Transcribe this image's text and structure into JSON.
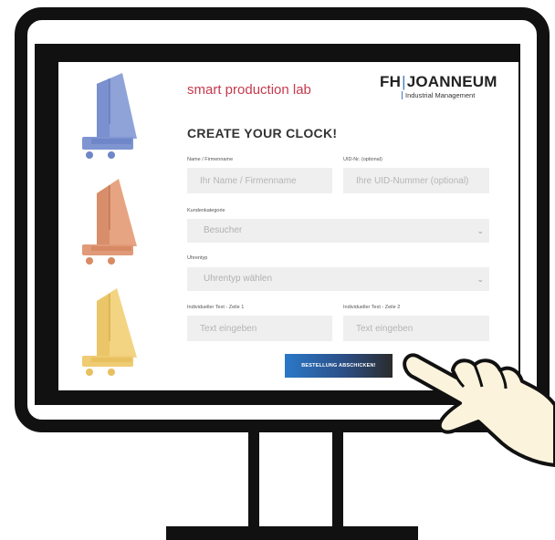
{
  "brand": {
    "lab_name": "smart production lab",
    "university_fh": "FH",
    "university_name": "JOANNEUM",
    "university_sub": "Industrial Management"
  },
  "form": {
    "title": "CREATE YOUR CLOCK!",
    "name_label": "Name / Firmenname",
    "name_placeholder": "Ihr Name / Firmenname",
    "uid_label": "UID-Nr. (optional)",
    "uid_placeholder": "Ihre UID-Nummer (optional)",
    "category_label": "Kundenkategorie",
    "category_value": "Besucher",
    "clocktype_label": "Uhrentyp",
    "clocktype_value": "Uhrentyp wählen",
    "text1_label": "Individueller Text - Zeile 1",
    "text1_placeholder": "Text eingeben",
    "text2_label": "Individueller Text - Zeile 2",
    "text2_placeholder": "Text eingeben",
    "submit_label": "BESTELLUNG ABSCHICKEN!",
    "chevron_icon": "chevron-down-icon"
  },
  "clocks": [
    {
      "color_front": "#8fa3d9",
      "color_side": "#6f86c8",
      "color_base": "#7e95d2"
    },
    {
      "color_front": "#e7a482",
      "color_side": "#d78a64",
      "color_base": "#e09a78"
    },
    {
      "color_front": "#f3d482",
      "color_side": "#e8c060",
      "color_base": "#efcb72"
    }
  ],
  "colors": {
    "accent_red": "#c43a4c",
    "accent_blue": "#2b78c9",
    "field_bg": "#efefef"
  }
}
